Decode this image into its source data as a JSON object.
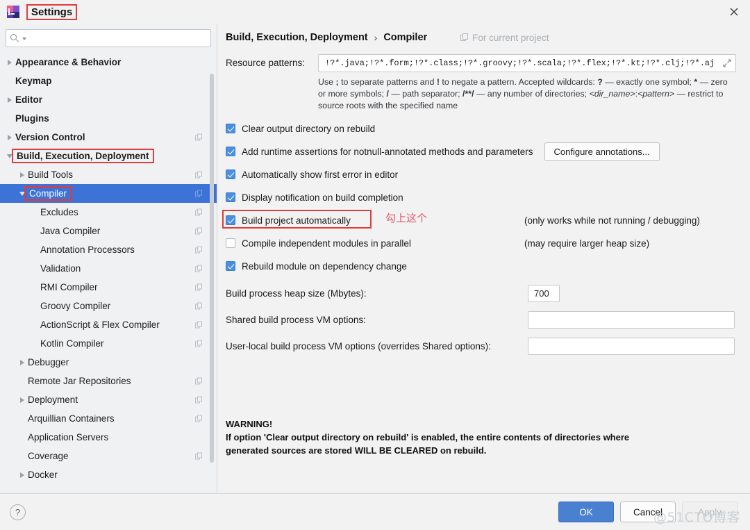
{
  "window": {
    "title": "Settings",
    "logo_icon": "intellij-idea-logo-icon",
    "close_icon": "close-icon"
  },
  "sidebar": {
    "search": {
      "value": "",
      "placeholder": "",
      "icon": "search-icon"
    },
    "items": [
      {
        "label": "Appearance & Behavior",
        "indent": 0,
        "arrow": "right",
        "bold": true,
        "copy": false,
        "selected": false
      },
      {
        "label": "Keymap",
        "indent": 0,
        "arrow": "none",
        "bold": true,
        "copy": false,
        "selected": false
      },
      {
        "label": "Editor",
        "indent": 0,
        "arrow": "right",
        "bold": true,
        "copy": false,
        "selected": false
      },
      {
        "label": "Plugins",
        "indent": 0,
        "arrow": "none",
        "bold": true,
        "copy": false,
        "selected": false
      },
      {
        "label": "Version Control",
        "indent": 0,
        "arrow": "right",
        "bold": true,
        "copy": true,
        "selected": false
      },
      {
        "label": "Build, Execution, Deployment",
        "indent": 0,
        "arrow": "down",
        "bold": true,
        "copy": false,
        "selected": false,
        "highlight": true
      },
      {
        "label": "Build Tools",
        "indent": 1,
        "arrow": "right",
        "bold": false,
        "copy": true,
        "selected": false
      },
      {
        "label": "Compiler",
        "indent": 1,
        "arrow": "down",
        "bold": false,
        "copy": true,
        "selected": true,
        "highlight": true
      },
      {
        "label": "Excludes",
        "indent": 2,
        "arrow": "none",
        "bold": false,
        "copy": true,
        "selected": false
      },
      {
        "label": "Java Compiler",
        "indent": 2,
        "arrow": "none",
        "bold": false,
        "copy": true,
        "selected": false
      },
      {
        "label": "Annotation Processors",
        "indent": 2,
        "arrow": "none",
        "bold": false,
        "copy": true,
        "selected": false
      },
      {
        "label": "Validation",
        "indent": 2,
        "arrow": "none",
        "bold": false,
        "copy": true,
        "selected": false
      },
      {
        "label": "RMI Compiler",
        "indent": 2,
        "arrow": "none",
        "bold": false,
        "copy": true,
        "selected": false
      },
      {
        "label": "Groovy Compiler",
        "indent": 2,
        "arrow": "none",
        "bold": false,
        "copy": true,
        "selected": false
      },
      {
        "label": "ActionScript & Flex Compiler",
        "indent": 2,
        "arrow": "none",
        "bold": false,
        "copy": true,
        "selected": false
      },
      {
        "label": "Kotlin Compiler",
        "indent": 2,
        "arrow": "none",
        "bold": false,
        "copy": true,
        "selected": false
      },
      {
        "label": "Debugger",
        "indent": 1,
        "arrow": "right",
        "bold": false,
        "copy": false,
        "selected": false
      },
      {
        "label": "Remote Jar Repositories",
        "indent": 1,
        "arrow": "none",
        "bold": false,
        "copy": true,
        "selected": false
      },
      {
        "label": "Deployment",
        "indent": 1,
        "arrow": "right",
        "bold": false,
        "copy": true,
        "selected": false
      },
      {
        "label": "Arquillian Containers",
        "indent": 1,
        "arrow": "none",
        "bold": false,
        "copy": true,
        "selected": false
      },
      {
        "label": "Application Servers",
        "indent": 1,
        "arrow": "none",
        "bold": false,
        "copy": false,
        "selected": false
      },
      {
        "label": "Coverage",
        "indent": 1,
        "arrow": "none",
        "bold": false,
        "copy": true,
        "selected": false
      },
      {
        "label": "Docker",
        "indent": 1,
        "arrow": "right",
        "bold": false,
        "copy": false,
        "selected": false
      }
    ]
  },
  "main": {
    "breadcrumb": {
      "parent": "Build, Execution, Deployment",
      "separator": "›",
      "current": "Compiler"
    },
    "for_current_project": {
      "label": "For current project",
      "icon": "copy-scope-icon"
    },
    "resource_patterns": {
      "label": "Resource patterns:",
      "value": "!?*.java;!?*.form;!?*.class;!?*.groovy;!?*.scala;!?*.flex;!?*.kt;!?*.clj;!?*.aj",
      "expand_icon": "expand-icon"
    },
    "hint": "Use ; to separate patterns and ! to negate a pattern. Accepted wildcards: ? — exactly one symbol; * — zero or more symbols; / — path separator; /**/ — any number of directories; <dir_name>:<pattern> — restrict to source roots with the specified name",
    "checkboxes": [
      {
        "label": "Clear output directory on rebuild",
        "checked": true,
        "note": "",
        "highlight": false
      },
      {
        "label": "Add runtime assertions for notnull-annotated methods and parameters",
        "checked": true,
        "note": "",
        "highlight": false,
        "button": "Configure annotations..."
      },
      {
        "label": "Automatically show first error in editor",
        "checked": true,
        "note": "",
        "highlight": false
      },
      {
        "label": "Display notification on build completion",
        "checked": true,
        "note": "",
        "highlight": false
      },
      {
        "label": "Build project automatically",
        "checked": true,
        "note": "(only works while not running / debugging)",
        "highlight": true,
        "annotation": "勾上这个"
      },
      {
        "label": "Compile independent modules in parallel",
        "checked": false,
        "note": "(may require larger heap size)",
        "highlight": false
      },
      {
        "label": "Rebuild module on dependency change",
        "checked": true,
        "note": "",
        "highlight": false
      }
    ],
    "fields": [
      {
        "label": "Build process heap size (Mbytes):",
        "value": "700",
        "size": "small"
      },
      {
        "label": "Shared build process VM options:",
        "value": "",
        "size": "wide"
      },
      {
        "label": "User-local build process VM options (overrides Shared options):",
        "value": "",
        "size": "wide"
      }
    ],
    "warning": {
      "title": "WARNING!",
      "line1": "If option 'Clear output directory on rebuild' is enabled, the entire contents of directories where",
      "line2": "generated sources are stored WILL BE CLEARED on rebuild."
    }
  },
  "footer": {
    "help_label": "?",
    "ok_label": "OK",
    "cancel_label": "Cancel",
    "apply_label": "Apply",
    "watermark": "@51CTO博客"
  },
  "colors": {
    "accent": "#3d72d7",
    "ok_button": "#4a80d0",
    "checkbox": "#4a90e2",
    "annotation_red": "#e23b3b",
    "annotation_text": "#e2546a"
  }
}
